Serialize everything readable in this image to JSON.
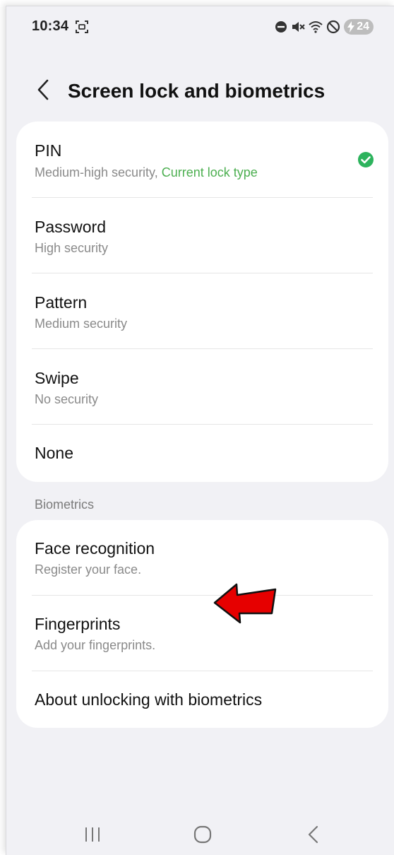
{
  "status_bar": {
    "time": "10:34",
    "battery_level": "24"
  },
  "header": {
    "title": "Screen lock and biometrics"
  },
  "lock_types": [
    {
      "title": "PIN",
      "subtitle": "Medium-high security, ",
      "subtitle_accent": "Current lock type",
      "selected": true
    },
    {
      "title": "Password",
      "subtitle": "High security"
    },
    {
      "title": "Pattern",
      "subtitle": "Medium security"
    },
    {
      "title": "Swipe",
      "subtitle": "No security"
    },
    {
      "title": "None",
      "subtitle": ""
    }
  ],
  "biometrics": {
    "section_label": "Biometrics",
    "items": [
      {
        "title": "Face recognition",
        "subtitle": "Register your face."
      },
      {
        "title": "Fingerprints",
        "subtitle": "Add your fingerprints."
      },
      {
        "title": "About unlocking with biometrics",
        "subtitle": ""
      }
    ]
  },
  "colors": {
    "accent_green": "#4caf50",
    "check_green": "#2db35d",
    "annotation_arrow": "#e60000",
    "background": "#f1f1f5"
  },
  "icons": {
    "back": "chevron-left-icon",
    "check": "check-circle-icon",
    "nav_recents": "recents-icon",
    "nav_home": "home-icon",
    "nav_back": "back-nav-icon"
  }
}
